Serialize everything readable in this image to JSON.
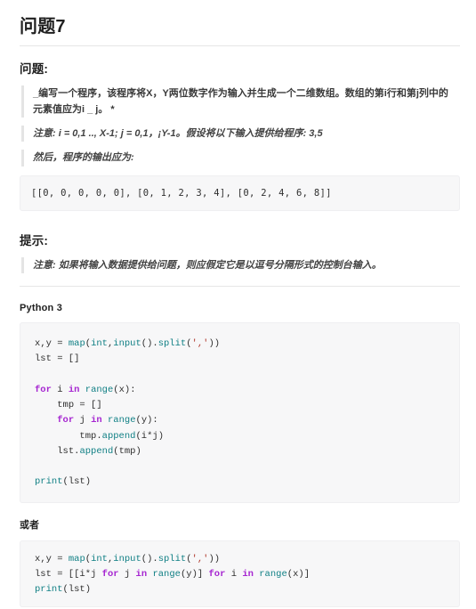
{
  "document": {
    "title": "问题7"
  },
  "sections": {
    "question": {
      "heading": "问题:",
      "quotes": [
        "_编写一个程序，该程序将X，Y两位数字作为输入并生成一个二维数组。数组的第i行和第j列中的元素值应为i _ j。 *",
        "注意: i = 0,1 .., X-1; j = 0,1，¡Y-1。假设将以下输入提供给程序: 3,5",
        "然后，程序的输出应为:"
      ],
      "output_code": "[[0, 0, 0, 0, 0], [0, 1, 2, 3, 4], [0, 2, 4, 6, 8]]"
    },
    "hint": {
      "heading": "提示:",
      "quote": "注意: 如果将输入数据提供给问题，则应假定它是以逗号分隔形式的控制台输入。"
    },
    "solution": {
      "lang_label": "Python 3",
      "alt_label": "或者",
      "code_primary": {
        "lines": [
          "x,y = map(int,input().split(','))",
          "lst = []",
          "",
          "for i in range(x):",
          "    tmp = []",
          "    for j in range(y):",
          "        tmp.append(i*j)",
          "    lst.append(tmp)",
          "",
          "print(lst)"
        ]
      },
      "code_alt": {
        "lines": [
          "x,y = map(int,input().split(','))",
          "lst = [[i*j for j in range(y)] for i in range(x)]",
          "print(lst)"
        ]
      }
    }
  },
  "colors": {
    "keyword": "#a626d1",
    "builtin": "#0f7f84",
    "string": "#b03a2e",
    "text": "#2f2f2f",
    "code_background": "#f7f7f8",
    "quote_border": "#e4e4e4",
    "rule": "#e6e6e6"
  }
}
